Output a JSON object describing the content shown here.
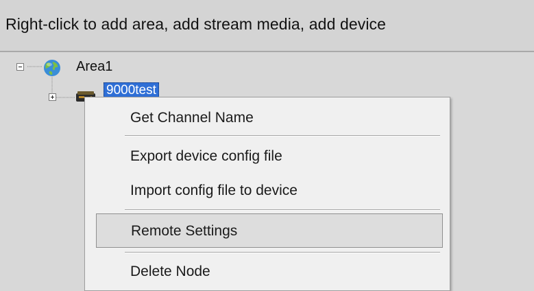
{
  "header": {
    "instruction": "Right-click to add area, add stream media, add device"
  },
  "tree": {
    "area_label": "Area1",
    "device_label": "9000test"
  },
  "context_menu": {
    "items": [
      {
        "label": "Get Channel Name"
      },
      {
        "label": "Export device config file"
      },
      {
        "label": "Import config file to device"
      },
      {
        "label": "Remote Settings",
        "highlighted": true
      },
      {
        "label": "Delete Node"
      }
    ]
  },
  "colors": {
    "selection": "#2f6fd6",
    "menu_background": "#f0f0f0",
    "panel_background": "#d8d8d8"
  },
  "icons": {
    "area": "globe-icon",
    "device": "dvr-device-icon"
  }
}
